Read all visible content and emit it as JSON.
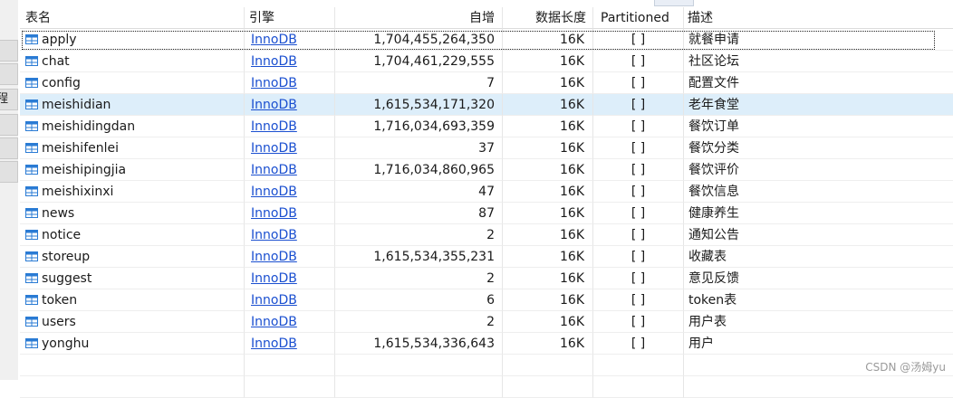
{
  "left_panel": {
    "partial_label": "程"
  },
  "columns": {
    "name": "表名",
    "engine": "引擎",
    "auto_increment": "自增",
    "data_length": "数据长度",
    "partitioned": "Partitioned",
    "description": "描述"
  },
  "rows": [
    {
      "name": "apply",
      "engine": "InnoDB",
      "auto_increment": "1,704,455,264,350",
      "data_length": "16K",
      "partitioned": "[  ]",
      "description": "就餐申请"
    },
    {
      "name": "chat",
      "engine": "InnoDB",
      "auto_increment": "1,704,461,229,555",
      "data_length": "16K",
      "partitioned": "[  ]",
      "description": "社区论坛"
    },
    {
      "name": "config",
      "engine": "InnoDB",
      "auto_increment": "7",
      "data_length": "16K",
      "partitioned": "[  ]",
      "description": "配置文件"
    },
    {
      "name": "meishidian",
      "engine": "InnoDB",
      "auto_increment": "1,615,534,171,320",
      "data_length": "16K",
      "partitioned": "[  ]",
      "description": "老年食堂"
    },
    {
      "name": "meishidingdan",
      "engine": "InnoDB",
      "auto_increment": "1,716,034,693,359",
      "data_length": "16K",
      "partitioned": "[  ]",
      "description": "餐饮订单"
    },
    {
      "name": "meishifenlei",
      "engine": "InnoDB",
      "auto_increment": "37",
      "data_length": "16K",
      "partitioned": "[  ]",
      "description": "餐饮分类"
    },
    {
      "name": "meishipingjia",
      "engine": "InnoDB",
      "auto_increment": "1,716,034,860,965",
      "data_length": "16K",
      "partitioned": "[  ]",
      "description": "餐饮评价"
    },
    {
      "name": "meishixinxi",
      "engine": "InnoDB",
      "auto_increment": "47",
      "data_length": "16K",
      "partitioned": "[  ]",
      "description": "餐饮信息"
    },
    {
      "name": "news",
      "engine": "InnoDB",
      "auto_increment": "87",
      "data_length": "16K",
      "partitioned": "[  ]",
      "description": "健康养生"
    },
    {
      "name": "notice",
      "engine": "InnoDB",
      "auto_increment": "2",
      "data_length": "16K",
      "partitioned": "[  ]",
      "description": "通知公告"
    },
    {
      "name": "storeup",
      "engine": "InnoDB",
      "auto_increment": "1,615,534,355,231",
      "data_length": "16K",
      "partitioned": "[  ]",
      "description": "收藏表"
    },
    {
      "name": "suggest",
      "engine": "InnoDB",
      "auto_increment": "2",
      "data_length": "16K",
      "partitioned": "[  ]",
      "description": "意见反馈"
    },
    {
      "name": "token",
      "engine": "InnoDB",
      "auto_increment": "6",
      "data_length": "16K",
      "partitioned": "[  ]",
      "description": "token表"
    },
    {
      "name": "users",
      "engine": "InnoDB",
      "auto_increment": "2",
      "data_length": "16K",
      "partitioned": "[  ]",
      "description": "用户表"
    },
    {
      "name": "yonghu",
      "engine": "InnoDB",
      "auto_increment": "1,615,534,336,643",
      "data_length": "16K",
      "partitioned": "[  ]",
      "description": "用户"
    }
  ],
  "selected_row": "meishidian",
  "focused_row": "apply",
  "watermark": "CSDN @汤姆yu",
  "colors": {
    "selected_bg": "#ddeefa",
    "link": "#1a4fd0",
    "icon_blue": "#2a7bd4"
  }
}
